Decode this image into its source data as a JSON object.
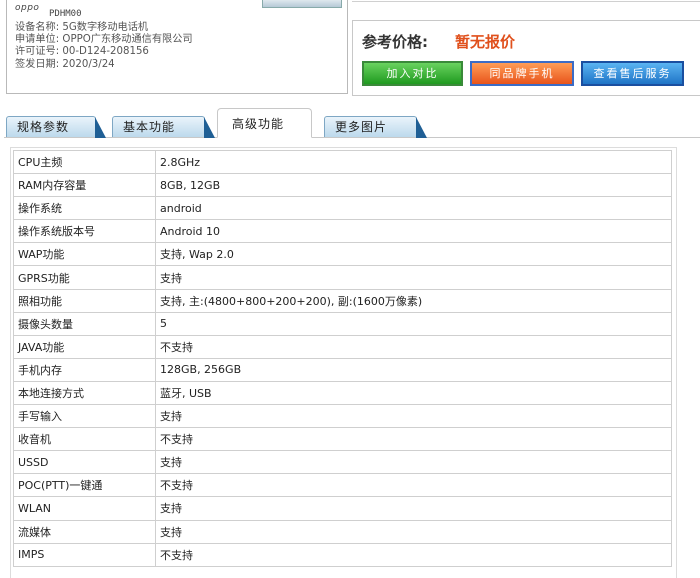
{
  "product": {
    "brand_logo": "oppo",
    "model_code": "PDHM00",
    "info_lines": [
      "设备名称: 5G数字移动电话机",
      "申请单位: OPPO广东移动通信有限公司",
      "许可证号: 00-D124-208156",
      "签发日期: 2020/3/24"
    ]
  },
  "price": {
    "label": "参考价格:",
    "value": "暂无报价",
    "value_color": "#e0501c"
  },
  "buttons": {
    "compare": "加入对比",
    "same_brand": "同品牌手机",
    "service": "查看售后服务"
  },
  "tabs": [
    {
      "label": "规格参数",
      "active": false
    },
    {
      "label": "基本功能",
      "active": false
    },
    {
      "label": "高级功能",
      "active": true
    },
    {
      "label": "更多图片",
      "active": false
    }
  ],
  "specs": [
    {
      "key": "CPU主频",
      "value": "2.8GHz"
    },
    {
      "key": "RAM内存容量",
      "value": "8GB, 12GB"
    },
    {
      "key": "操作系统",
      "value": "android"
    },
    {
      "key": "操作系统版本号",
      "value": "Android 10"
    },
    {
      "key": "WAP功能",
      "value": "支持, Wap 2.0"
    },
    {
      "key": "GPRS功能",
      "value": "支持"
    },
    {
      "key": "照相功能",
      "value": "支持, 主:(4800+800+200+200), 副:(1600万像素)"
    },
    {
      "key": "摄像头数量",
      "value": "5"
    },
    {
      "key": "JAVA功能",
      "value": "不支持"
    },
    {
      "key": "手机内存",
      "value": "128GB, 256GB"
    },
    {
      "key": "本地连接方式",
      "value": "蓝牙, USB"
    },
    {
      "key": "手写输入",
      "value": "支持"
    },
    {
      "key": "收音机",
      "value": "不支持"
    },
    {
      "key": "USSD",
      "value": "支持"
    },
    {
      "key": "POC(PTT)一键通",
      "value": "不支持"
    },
    {
      "key": "WLAN",
      "value": "支持"
    },
    {
      "key": "流媒体",
      "value": "支持"
    },
    {
      "key": "IMPS",
      "value": "不支持"
    }
  ]
}
